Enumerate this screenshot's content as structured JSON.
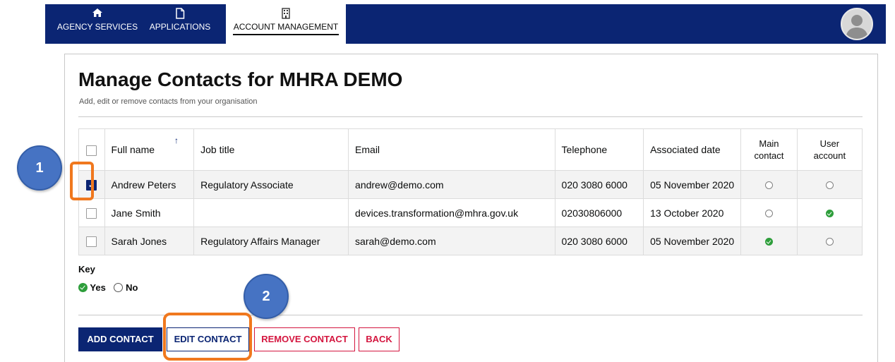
{
  "nav": {
    "items": [
      {
        "label": "AGENCY SERVICES",
        "icon": "home-icon"
      },
      {
        "label": "APPLICATIONS",
        "icon": "document-icon"
      },
      {
        "label": "ACCOUNT MANAGEMENT",
        "icon": "building-icon",
        "active": true
      }
    ],
    "avatar_icon": "user-avatar-icon"
  },
  "page": {
    "title": "Manage Contacts for MHRA DEMO",
    "subtitle": "Add, edit or remove contacts from your organisation"
  },
  "table": {
    "headers": {
      "full_name": "Full name",
      "job_title": "Job title",
      "email": "Email",
      "telephone": "Telephone",
      "associated_date": "Associated date",
      "main_contact": "Main contact",
      "user_account": "User account"
    },
    "sort_indicator": "↑",
    "rows": [
      {
        "checked": true,
        "full_name": "Andrew Peters",
        "job_title": "Regulatory Associate",
        "email": "andrew@demo.com",
        "telephone": "020 3080 6000",
        "associated_date": "05 November 2020",
        "main_contact": false,
        "user_account": false
      },
      {
        "checked": false,
        "full_name": "Jane Smith",
        "job_title": "",
        "email": "devices.transformation@mhra.gov.uk",
        "telephone": "02030806000",
        "associated_date": "13 October 2020",
        "main_contact": false,
        "user_account": true
      },
      {
        "checked": false,
        "full_name": "Sarah Jones",
        "job_title": "Regulatory Affairs Manager",
        "email": "sarah@demo.com",
        "telephone": "020 3080 6000",
        "associated_date": "05 November 2020",
        "main_contact": true,
        "user_account": false
      }
    ]
  },
  "key": {
    "label": "Key",
    "yes": "Yes",
    "no": "No"
  },
  "buttons": {
    "add": "ADD CONTACT",
    "edit": "EDIT CONTACT",
    "remove": "REMOVE CONTACT",
    "back": "BACK"
  },
  "annotations": {
    "step1": "1",
    "step2": "2",
    "highlight_color": "#f0781e",
    "badge_color": "#4673c3"
  },
  "colors": {
    "navy": "#0b2573",
    "danger": "#d4163f",
    "success": "#2e9e3b"
  }
}
